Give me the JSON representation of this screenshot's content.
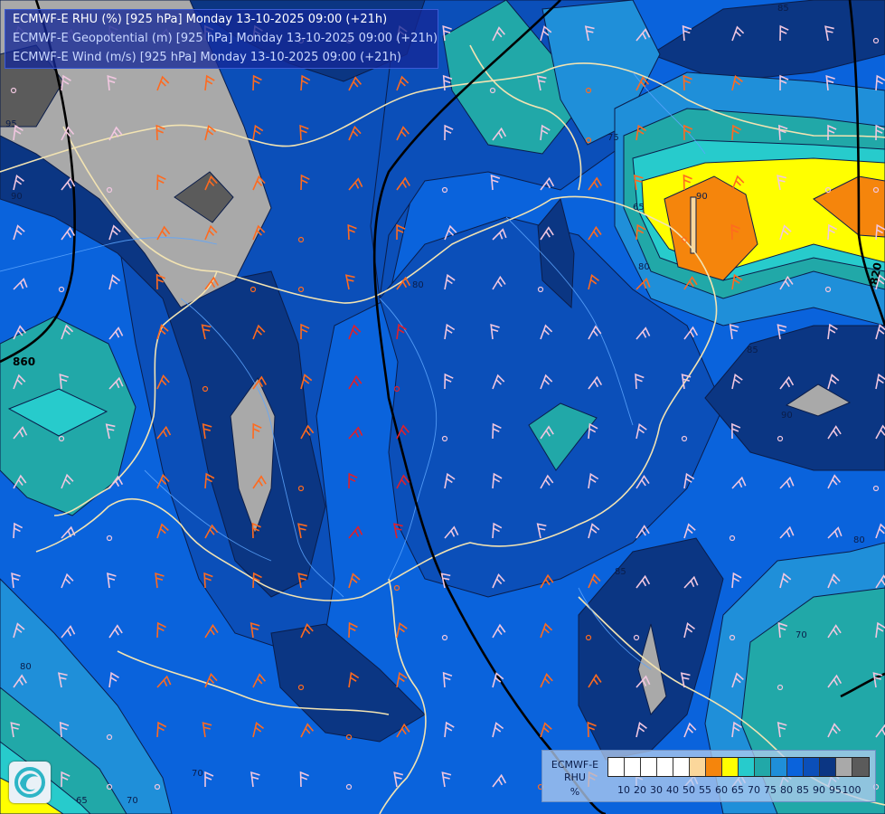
{
  "title_lines": [
    "ECMWF-E RHU (%) [925 hPa] Monday 13-10-2025 09:00 (+21h)",
    "ECMWF-E Geopotential (m) [925 hPa] Monday 13-10-2025 09:00 (+21h)",
    "ECMWF-E Wind (m/s) [925 hPa] Monday 13-10-2025 09:00 (+21h)"
  ],
  "legend": {
    "title": [
      "ECMWF-E",
      "RHU",
      "%"
    ],
    "colors": [
      "#ffffff",
      "#ffffff",
      "#ffffff",
      "#ffffff",
      "#ffffff",
      "#fbd79b",
      "#f5850c",
      "#ffff00",
      "#27cbcc",
      "#21a8a8",
      "#1f8fd9",
      "#0a63dc",
      "#0b4fb9",
      "#0b3683",
      "#a9a9a9",
      "#5b5b5b"
    ],
    "ticks": [
      "10",
      "20",
      "30",
      "40",
      "50",
      "55",
      "60",
      "65",
      "70",
      "75",
      "80",
      "85",
      "90",
      "95",
      "100"
    ]
  },
  "contour_labels": {
    "rhu": [
      "95",
      "90",
      "85",
      "80",
      "75",
      "65",
      "80",
      "85",
      "90",
      "85",
      "80",
      "70",
      "65",
      "70",
      "70",
      "80",
      "90"
    ],
    "geopotential": [
      "860",
      "820"
    ]
  },
  "icons": {
    "logo": "weather-agency-logo"
  }
}
